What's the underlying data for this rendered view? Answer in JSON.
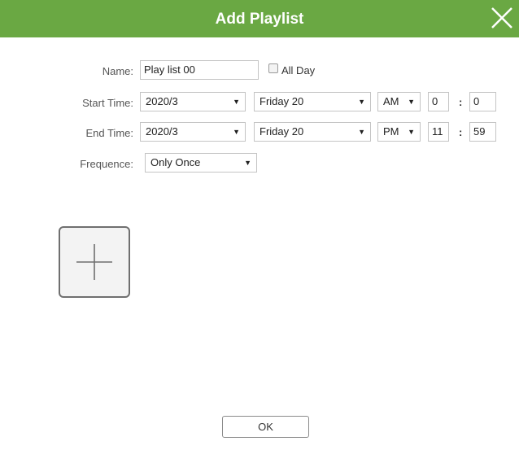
{
  "dialog": {
    "title": "Add Playlist",
    "close_icon": "close-icon",
    "header_color": "#6aa843"
  },
  "form": {
    "name_label": "Name:",
    "name_value": "Play list 00",
    "all_day_label": "All Day",
    "all_day_checked": false,
    "start_label": "Start Time:",
    "start_month": "2020/3",
    "start_day": "Friday 20",
    "start_ampm": "AM",
    "start_hour": "0",
    "start_minute": "0",
    "end_label": "End Time:",
    "end_month": "2020/3",
    "end_day": "Friday 20",
    "end_ampm": "PM",
    "end_hour": "11",
    "end_minute": "59",
    "frequence_label": "Frequence:",
    "frequence_value": "Only Once",
    "time_separator": ":",
    "dropdown_icon": "caret-down-icon"
  },
  "add_tile": {
    "icon": "plus-icon"
  },
  "footer": {
    "ok_label": "OK"
  }
}
